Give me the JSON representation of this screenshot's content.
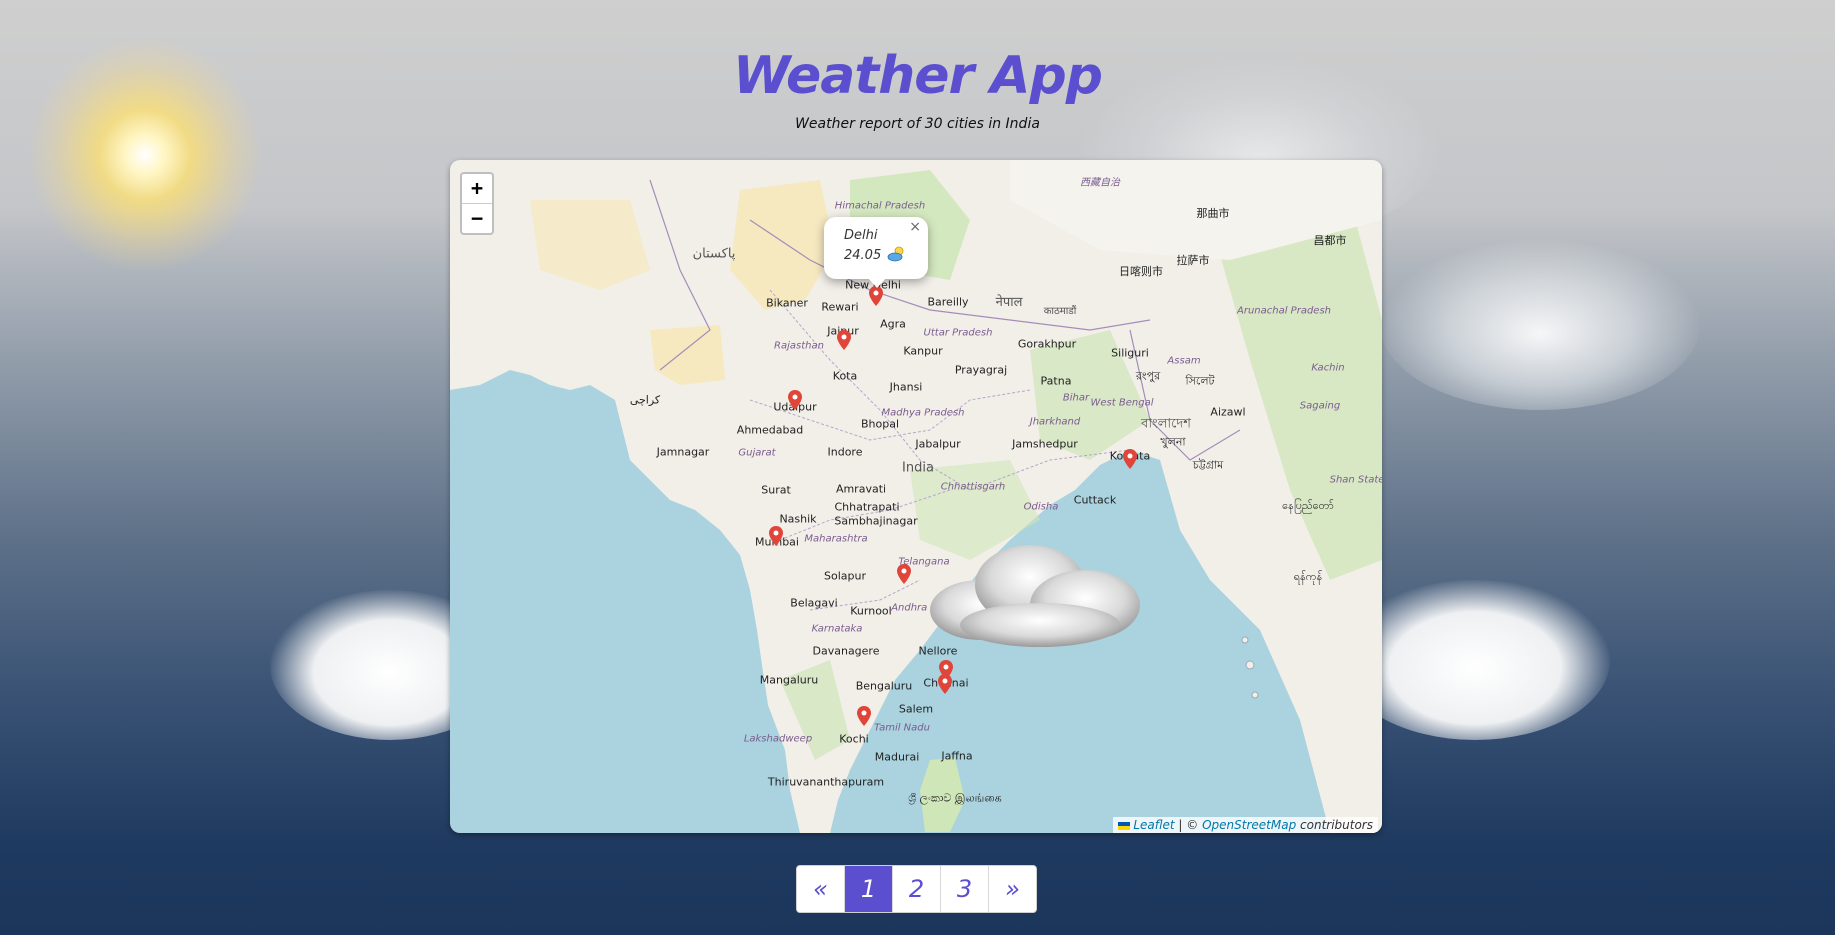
{
  "header": {
    "title": "Weather App",
    "subtitle": "Weather report of 30 cities in India"
  },
  "map": {
    "zoom_in": "+",
    "zoom_out": "−",
    "popup": {
      "city": "Delhi",
      "temperature": "24.05",
      "close": "×",
      "icon": "partly-cloudy-icon"
    },
    "attribution": {
      "leaflet": "Leaflet",
      "separator": " | © ",
      "osm": "OpenStreetMap",
      "suffix": " contributors"
    },
    "places": {
      "new_delhi": "New Delhi",
      "rewari": "Rewari",
      "agra": "Agra",
      "jaipur": "Jaipur",
      "kota": "Kota",
      "bareilly": "Bareilly",
      "kanpur": "Kanpur",
      "prayagraj": "Prayagraj",
      "gorakhpur": "Gorakhpur",
      "patna": "Patna",
      "siliguri": "Siliguri",
      "bikaner": "Bikaner",
      "jhansi": "Jhansi",
      "bhopal": "Bhopal",
      "udaipur": "Udaipur",
      "ahmedabad": "Ahmedabad",
      "jamnagar": "Jamnagar",
      "indore": "Indore",
      "jabalpur": "Jabalpur",
      "jamshedpur": "Jamshedpur",
      "kolkata": "Kolkata",
      "surat": "Surat",
      "amravati": "Amravati",
      "india": "India",
      "cuttack": "Cuttack",
      "nashik": "Nashik",
      "chhatrapati": "Chhatrapati",
      "sambhajinagar": "Sambhajinagar",
      "mumbai": "Mumbai",
      "solapur": "Solapur",
      "belagavi": "Belagavi",
      "kurnool": "Kurnool",
      "davanagere": "Davanagere",
      "nellore": "Nellore",
      "mangaluru": "Mangaluru",
      "bengaluru": "Bengaluru",
      "chennai": "Chennai",
      "salem": "Salem",
      "kochi": "Kochi",
      "madurai": "Madurai",
      "jaffna": "Jaffna",
      "thiruvananthapuram": "Thiruvananthapuram",
      "aizawl": "Aizawl",
      "karachi": "کراچی",
      "pakistan": "پاکستان",
      "srilanka": "ශ්‍රී ලංකාව இலங்கை",
      "rajasthan": "Rajasthan",
      "uttar_pradesh": "Uttar Pradesh",
      "madhya_pradesh": "Madhya Pradesh",
      "bihar": "Bihar",
      "jharkhand": "Jharkhand",
      "west_bengal": "West Bengal",
      "gujarat": "Gujarat",
      "chhattisgarh": "Chhattisgarh",
      "odisha": "Odisha",
      "maharashtra": "Maharashtra",
      "telangana": "Telangana",
      "andhra_pradesh": "Andhra Pradesh",
      "karnataka": "Karnataka",
      "tamil_nadu": "Tamil Nadu",
      "lakshadweep": "Lakshadweep",
      "himachal": "Himachal Pradesh",
      "assam": "Assam",
      "arunachal": "Arunachal Pradesh",
      "nepal": "नेपाल",
      "kathmandu": "काठमाडौं",
      "tibet": "西藏自治",
      "shigatse": "日喀则市",
      "lhasa": "拉萨市",
      "nagqu": "那曲市",
      "chamdo": "昌都市",
      "kachin": "Kachin",
      "sagaing": "Sagaing",
      "shan": "Shan State",
      "bangladesh": "বাংলাদেশ",
      "khulna": "খুলনা",
      "chattogram": "চট্টগ্রাম",
      "sylhet": "সিলেট",
      "rangpur": "রংপুর",
      "naypyidaw": "နေပြည်တော်",
      "yangon": "ရန်ကုန်"
    },
    "markers": [
      "delhi",
      "jaipur",
      "udaipur",
      "mumbai",
      "hyderabad",
      "chennai",
      "chennai-2",
      "kochi",
      "kolkata"
    ]
  },
  "pagination": {
    "prev": "«",
    "pages": [
      "1",
      "2",
      "3"
    ],
    "next": "»",
    "active": "1"
  }
}
